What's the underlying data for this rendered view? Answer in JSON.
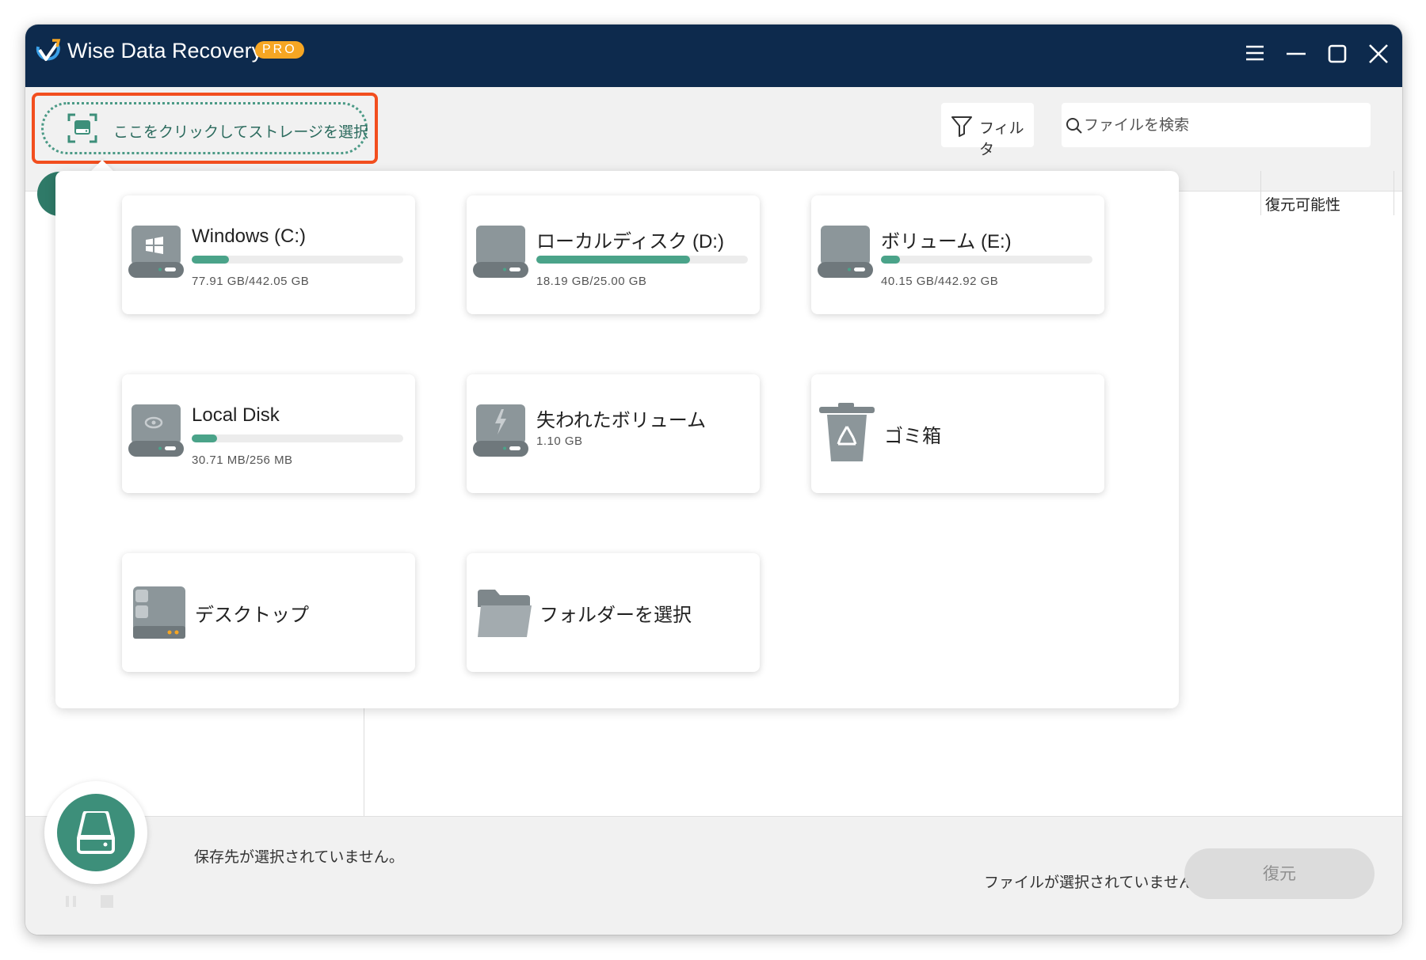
{
  "app": {
    "title": "Wise Data Recovery",
    "badge": "PRO",
    "brand_color": "#0d2a4d",
    "accent_color": "#3d8f7a"
  },
  "window_controls": [
    "menu-icon",
    "minimize-icon",
    "maximize-icon",
    "close-icon"
  ],
  "toolbar": {
    "storage_select_label": "ここをクリックしてストレージを選択",
    "filter_label": "フィルタ",
    "search_placeholder": "ファイルを検索"
  },
  "results": {
    "column_header": "復元可能性"
  },
  "storage": {
    "c": {
      "name": "Windows (C:)",
      "size": "77.91 GB/442.05 GB",
      "used_fraction": 0.176,
      "icon": "windows-drive-icon"
    },
    "d": {
      "name": "ローカルディスク (D:)",
      "size": "18.19 GB/25.00 GB",
      "used_fraction": 0.728,
      "icon": "hard-drive-icon"
    },
    "e": {
      "name": "ボリューム (E:)",
      "size": "40.15 GB/442.92 GB",
      "used_fraction": 0.091,
      "icon": "hard-drive-icon"
    },
    "local": {
      "name": "Local Disk",
      "size": "30.71 MB/256 MB",
      "used_fraction": 0.12,
      "icon": "hard-drive-icon"
    },
    "lost": {
      "name": "失われたボリューム",
      "size": "1.10 GB",
      "icon": "lost-volume-icon"
    },
    "trash": {
      "name": "ゴミ箱",
      "icon": "recycle-bin-icon"
    },
    "desktop": {
      "name": "デスクトップ",
      "icon": "desktop-icon"
    },
    "folder": {
      "name": "フォルダーを選択",
      "icon": "folder-icon"
    }
  },
  "bottom": {
    "destination_text": "保存先が選択されていません。",
    "status_text": "ファイルが選択されていません。",
    "restore_label": "復元"
  }
}
